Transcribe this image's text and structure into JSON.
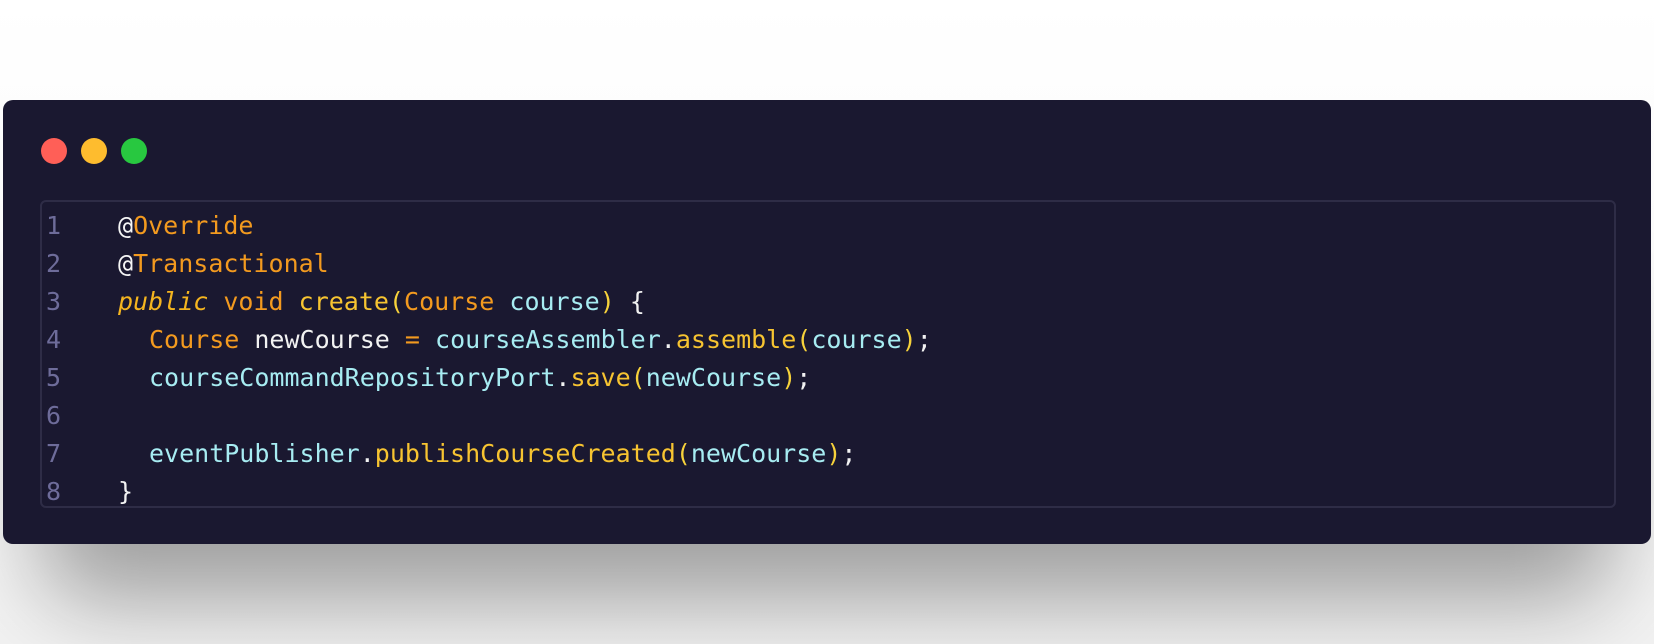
{
  "window": {
    "controls": [
      {
        "name": "close",
        "color": "#ff5f57"
      },
      {
        "name": "minimize",
        "color": "#febc2e"
      },
      {
        "name": "maximize",
        "color": "#28c840"
      }
    ]
  },
  "code": {
    "lines": [
      {
        "num": "1",
        "tokens": [
          [
            "@",
            "anno-at"
          ],
          [
            "Override",
            "anno"
          ]
        ]
      },
      {
        "num": "2",
        "tokens": [
          [
            "@",
            "anno-at"
          ],
          [
            "Transactional",
            "anno"
          ]
        ]
      },
      {
        "num": "3",
        "tokens": [
          [
            "public",
            "kw-it"
          ],
          [
            " ",
            "plain"
          ],
          [
            "void",
            "kw"
          ],
          [
            " ",
            "plain"
          ],
          [
            "create",
            "fn"
          ],
          [
            "(",
            "paren"
          ],
          [
            "Course",
            "type"
          ],
          [
            " ",
            "plain"
          ],
          [
            "course",
            "var"
          ],
          [
            ")",
            "paren"
          ],
          [
            " {",
            "punc"
          ]
        ]
      },
      {
        "num": "4",
        "tokens": [
          [
            "Course",
            "type"
          ],
          [
            " newCourse ",
            "plain"
          ],
          [
            "=",
            "op"
          ],
          [
            " ",
            "plain"
          ],
          [
            "courseAssembler",
            "var"
          ],
          [
            ".",
            "punc"
          ],
          [
            "assemble",
            "fn"
          ],
          [
            "(",
            "paren"
          ],
          [
            "course",
            "var"
          ],
          [
            ")",
            "paren"
          ],
          [
            ";",
            "punc"
          ]
        ]
      },
      {
        "num": "5",
        "tokens": [
          [
            "courseCommandRepositoryPort",
            "var"
          ],
          [
            ".",
            "punc"
          ],
          [
            "save",
            "fn"
          ],
          [
            "(",
            "paren"
          ],
          [
            "newCourse",
            "var"
          ],
          [
            ")",
            "paren"
          ],
          [
            ";",
            "punc"
          ]
        ]
      },
      {
        "num": "6",
        "tokens": []
      },
      {
        "num": "7",
        "tokens": [
          [
            "eventPublisher",
            "var"
          ],
          [
            ".",
            "punc"
          ],
          [
            "publishCourseCreated",
            "fn"
          ],
          [
            "(",
            "paren"
          ],
          [
            "newCourse",
            "var"
          ],
          [
            ")",
            "paren"
          ],
          [
            ";",
            "punc"
          ]
        ]
      },
      {
        "num": "8",
        "tokens": [
          [
            "}",
            "punc"
          ]
        ]
      }
    ]
  }
}
